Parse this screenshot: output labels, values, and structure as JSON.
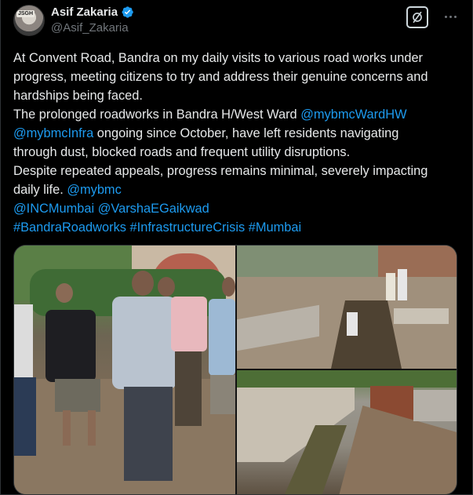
{
  "author": {
    "display_name": "Asif Zakaria",
    "handle": "@Asif_Zakaria",
    "avatar_text": "JSGH",
    "verified": true
  },
  "tweet": {
    "lines": [
      {
        "parts": [
          {
            "text": "At Convent Road, Bandra on my daily visits to various road works under",
            "link": false
          }
        ]
      },
      {
        "parts": [
          {
            "text": "progress, meeting citizens to try and address their genuine concerns and",
            "link": false
          }
        ]
      },
      {
        "parts": [
          {
            "text": "hardships being faced.",
            "link": false
          }
        ]
      },
      {
        "parts": [
          {
            "text": "The prolonged roadworks in Bandra H/West Ward ",
            "link": false
          },
          {
            "text": "@mybmcWardHW",
            "link": true
          }
        ]
      },
      {
        "parts": [
          {
            "text": "@mybmcInfra",
            "link": true
          },
          {
            "text": " ongoing since October, have left residents navigating",
            "link": false
          }
        ]
      },
      {
        "parts": [
          {
            "text": "through dust, blocked roads and frequent utility disruptions.",
            "link": false
          }
        ]
      },
      {
        "parts": [
          {
            "text": "Despite repeated appeals, progress remains minimal, severely impacting",
            "link": false
          }
        ]
      },
      {
        "parts": [
          {
            "text": "daily life. ",
            "link": false
          },
          {
            "text": "@mybmc",
            "link": true
          }
        ]
      },
      {
        "parts": [
          {
            "text": "@INCMumbai",
            "link": true
          },
          {
            "text": " ",
            "link": false
          },
          {
            "text": "@VarshaEGaikwad",
            "link": true
          }
        ]
      },
      {
        "parts": [
          {
            "text": "#BandraRoadworks",
            "link": true
          },
          {
            "text": " ",
            "link": false
          },
          {
            "text": "#InfrastructureCrisis",
            "link": true
          },
          {
            "text": " ",
            "link": false
          },
          {
            "text": "#Mumbai",
            "link": true
          }
        ]
      }
    ]
  },
  "media": {
    "photos": [
      {
        "name": "photo-people-at-roadworks"
      },
      {
        "name": "photo-trench-street"
      },
      {
        "name": "photo-drain-excavation"
      }
    ]
  },
  "icons": {
    "verified": "verified-badge-icon",
    "grok": "grok-icon",
    "more": "more-options-icon"
  },
  "colors": {
    "background": "#000000",
    "text": "#e7e9ea",
    "secondary": "#71767b",
    "link": "#1d9bf0",
    "verified": "#1d9bf0"
  }
}
